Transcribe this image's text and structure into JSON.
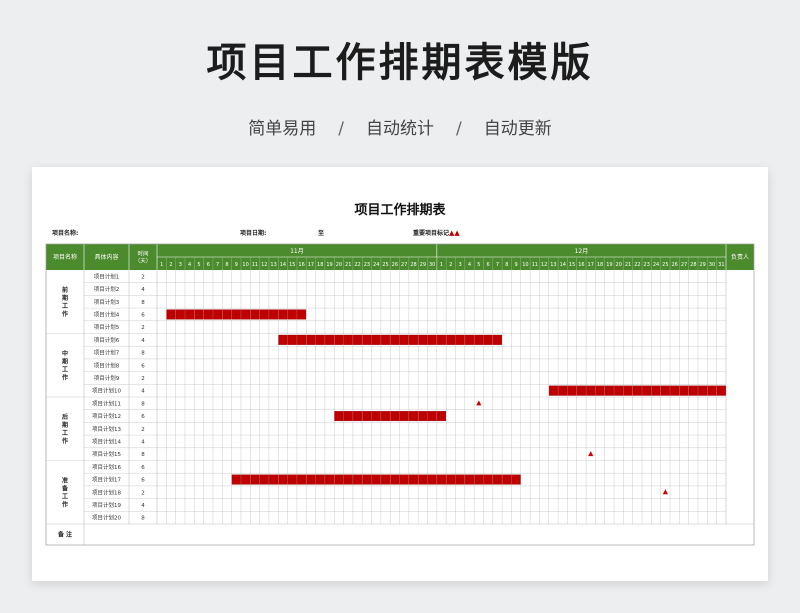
{
  "page": {
    "title": "项目工作排期表模版",
    "subtitle_items": [
      "简单易用",
      "自动统计",
      "自动更新"
    ],
    "subtitle_sep": "/"
  },
  "sheet": {
    "title": "项目工作排期表",
    "project_name_label": "项目名称:",
    "project_date_label": "项目日期:",
    "date_to": "至",
    "milestone_label": "重要项目标记",
    "milestone_symbols": "▲▲",
    "headers": {
      "name": "项目名称",
      "content": "具体内容",
      "time": "时间\n（天）",
      "owner": "负责人"
    },
    "months": [
      {
        "label": "11月",
        "days": 30
      },
      {
        "label": "12月",
        "days": 31
      }
    ],
    "colors": {
      "header_green": "#4c8a2e",
      "bar_red": "#c00000",
      "milestone_red": "#d00000",
      "grid_line": "#bfbfbf"
    },
    "groups": [
      {
        "label": "前期工作",
        "start": 0,
        "count": 5
      },
      {
        "label": "中期工作",
        "start": 5,
        "count": 5
      },
      {
        "label": "后期工作",
        "start": 10,
        "count": 5
      },
      {
        "label": "准备工作",
        "start": 15,
        "count": 5
      }
    ],
    "rows": [
      {
        "item": "项目计划1",
        "days": "2"
      },
      {
        "item": "项目计划2",
        "days": "4"
      },
      {
        "item": "项目计划3",
        "days": "8"
      },
      {
        "item": "项目计划4",
        "days": "6",
        "bar": [
          1,
          16
        ]
      },
      {
        "item": "项目计划5",
        "days": "2"
      },
      {
        "item": "项目计划6",
        "days": "4",
        "bar": [
          13,
          37
        ]
      },
      {
        "item": "项目计划7",
        "days": "8"
      },
      {
        "item": "项目计划8",
        "days": "6"
      },
      {
        "item": "项目计划9",
        "days": "2"
      },
      {
        "item": "项目计划10",
        "days": "4",
        "bar": [
          42,
          61
        ]
      },
      {
        "item": "项目计划11",
        "days": "8",
        "milestone": 34
      },
      {
        "item": "项目计划12",
        "days": "6",
        "bar": [
          19,
          31
        ]
      },
      {
        "item": "项目计划13",
        "days": "2"
      },
      {
        "item": "项目计划14",
        "days": "4"
      },
      {
        "item": "项目计划15",
        "days": "8",
        "milestone": 46
      },
      {
        "item": "项目计划16",
        "days": "6"
      },
      {
        "item": "项目计划17",
        "days": "6",
        "bar": [
          8,
          39
        ]
      },
      {
        "item": "项目计划18",
        "days": "2",
        "milestone": 54
      },
      {
        "item": "项目计划19",
        "days": "4"
      },
      {
        "item": "项目计划20",
        "days": "8"
      }
    ],
    "remarks_label": "备    注"
  }
}
